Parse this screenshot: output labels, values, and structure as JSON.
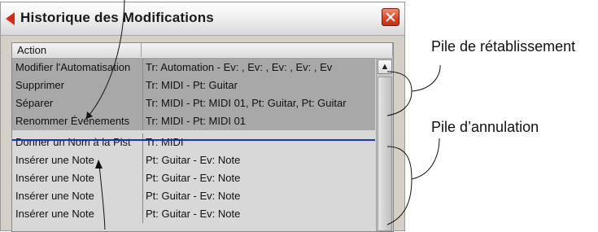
{
  "window": {
    "title": "Historique des Modifications",
    "close_icon": "close-icon"
  },
  "table": {
    "columns": [
      "Action",
      ""
    ],
    "rows": [
      {
        "action": "Modifier l'Automatisation",
        "detail": "Tr: Automation - Ev: , Ev: , Ev: , Ev: , Ev",
        "stack": "redo"
      },
      {
        "action": "Supprimer",
        "detail": "Tr: MIDI - Pt: Guitar",
        "stack": "redo"
      },
      {
        "action": "Séparer",
        "detail": "Tr: MIDI - Pt: MIDI 01, Pt: Guitar, Pt: Guitar",
        "stack": "redo"
      },
      {
        "action": "Renommer Événements",
        "detail": "Tr: MIDI - Pt: MIDI 01",
        "stack": "redo"
      },
      {
        "action": "Donner un Nom à la Pist",
        "detail": "Tr: MIDI",
        "stack": "undo"
      },
      {
        "action": "Insérer une Note",
        "detail": "Pt: Guitar - Ev: Note",
        "stack": "undo"
      },
      {
        "action": "Insérer une Note",
        "detail": "Pt: Guitar - Ev: Note",
        "stack": "undo"
      },
      {
        "action": "Insérer une Note",
        "detail": "Pt: Guitar - Ev: Note",
        "stack": "undo"
      },
      {
        "action": "Insérer une Note",
        "detail": "Pt: Guitar - Ev: Note",
        "stack": "undo"
      }
    ]
  },
  "scrollbar": {
    "up_icon": "scroll-up-arrow-icon"
  },
  "annotations": {
    "redo_stack": "Pile de rétablissement",
    "undo_stack": "Pile d’annulation"
  },
  "colors": {
    "redo_background": "#a8a8a8",
    "undo_background": "#d8d8d8",
    "divider": "#1f31b8",
    "close_button": "#d8431f"
  }
}
